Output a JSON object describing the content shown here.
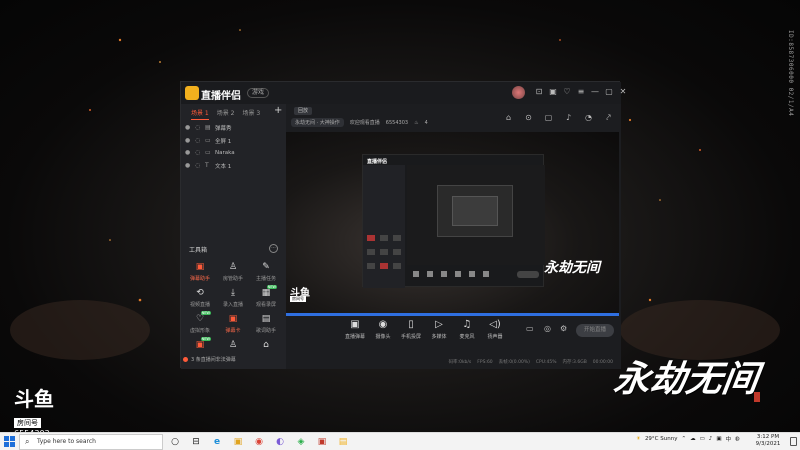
{
  "desktop": {
    "side_id": "ID:8587306000 02/1/A4",
    "brand_mark": "斗鱼",
    "brand_tag": "房间号",
    "brand_room": "6554303",
    "calligraphy": "永劫无间"
  },
  "app": {
    "name": "直播伴侣",
    "badge": "游戏",
    "title_icons": [
      "⊡",
      "▣",
      "♡",
      "≡",
      "—",
      "▢",
      "✕"
    ],
    "scene_tabs": [
      "场景 1",
      "场景 2",
      "场景 3"
    ],
    "add_scene": "+",
    "sources": [
      {
        "label": "弹幕秀",
        "icon": "▤"
      },
      {
        "label": "全屏 1",
        "icon": "▭"
      },
      {
        "label": "Naraka",
        "icon": "▭"
      },
      {
        "label": "文本 1",
        "icon": "T"
      }
    ],
    "tools_title": "工具箱",
    "tools_more": "···",
    "tools": [
      {
        "label": "弹幕助手",
        "icon": "▣",
        "hot": true,
        "badge": ""
      },
      {
        "label": "房管助手",
        "icon": "♙",
        "hot": false,
        "badge": ""
      },
      {
        "label": "主播任务",
        "icon": "✎",
        "hot": false,
        "badge": ""
      },
      {
        "label": "视频直播",
        "icon": "⟲",
        "hot": false,
        "badge": ""
      },
      {
        "label": "录入直播",
        "icon": "⤓",
        "hot": false,
        "badge": ""
      },
      {
        "label": "观看录屏",
        "icon": "▦",
        "hot": false,
        "badge": "NEW"
      },
      {
        "label": "虚拟形象",
        "icon": "♡",
        "hot": false,
        "badge": "NEW"
      },
      {
        "label": "弹幕卡",
        "icon": "▣",
        "hot": true,
        "badge": ""
      },
      {
        "label": "歌词助手",
        "icon": "▤",
        "hot": false,
        "badge": ""
      },
      {
        "label": "",
        "icon": "▣",
        "hot": false,
        "badge": "NEW"
      },
      {
        "label": "",
        "icon": "♙",
        "hot": false,
        "badge": ""
      },
      {
        "label": "",
        "icon": "⌂",
        "hot": false,
        "badge": ""
      }
    ],
    "notice": "3 条直播间非法弹幕"
  },
  "main": {
    "room_tag": "回放",
    "room_category": "永劫无间 · 大神操作",
    "room_title": "欢迎观看直播",
    "room_id": "6554303",
    "heat": "4",
    "header_icons": [
      "⌂",
      "⊙",
      "▢",
      "♪",
      "◔",
      "⤤"
    ],
    "preview_app_title": "直播伴侣",
    "preview_brand": "永劫无间",
    "preview_douyu": "斗鱼",
    "preview_douyu_tag": "房间号",
    "toolbar": [
      {
        "label": "直播弹幕",
        "icon": "▣"
      },
      {
        "label": "摄像头",
        "icon": "◉"
      },
      {
        "label": "手机投屏",
        "icon": "▯"
      },
      {
        "label": "多媒体",
        "icon": "▷"
      },
      {
        "label": "麦克风",
        "icon": "♫"
      },
      {
        "label": "扬声器",
        "icon": "◁)"
      }
    ],
    "mini_icons": [
      "▭",
      "◎",
      "⚙"
    ],
    "go_live": "开始直播",
    "status": [
      "码率:0kb/s",
      "FPS:60",
      "丢帧:0(0.00%)",
      "CPU:45%",
      "内存:3.6GB",
      "00:00:00"
    ]
  },
  "taskbar": {
    "search_placeholder": "Type here to search",
    "apps": [
      "○",
      "⊟",
      "e",
      "▣",
      "◉",
      "◐",
      "◈",
      "▣",
      "▤"
    ],
    "weather": "29°C  Sunny",
    "tray_icons": [
      "⌃",
      "☁",
      "▭",
      "♪",
      "▣",
      "中",
      "◍"
    ],
    "time": "3:12 PM",
    "date": "9/3/2021"
  }
}
